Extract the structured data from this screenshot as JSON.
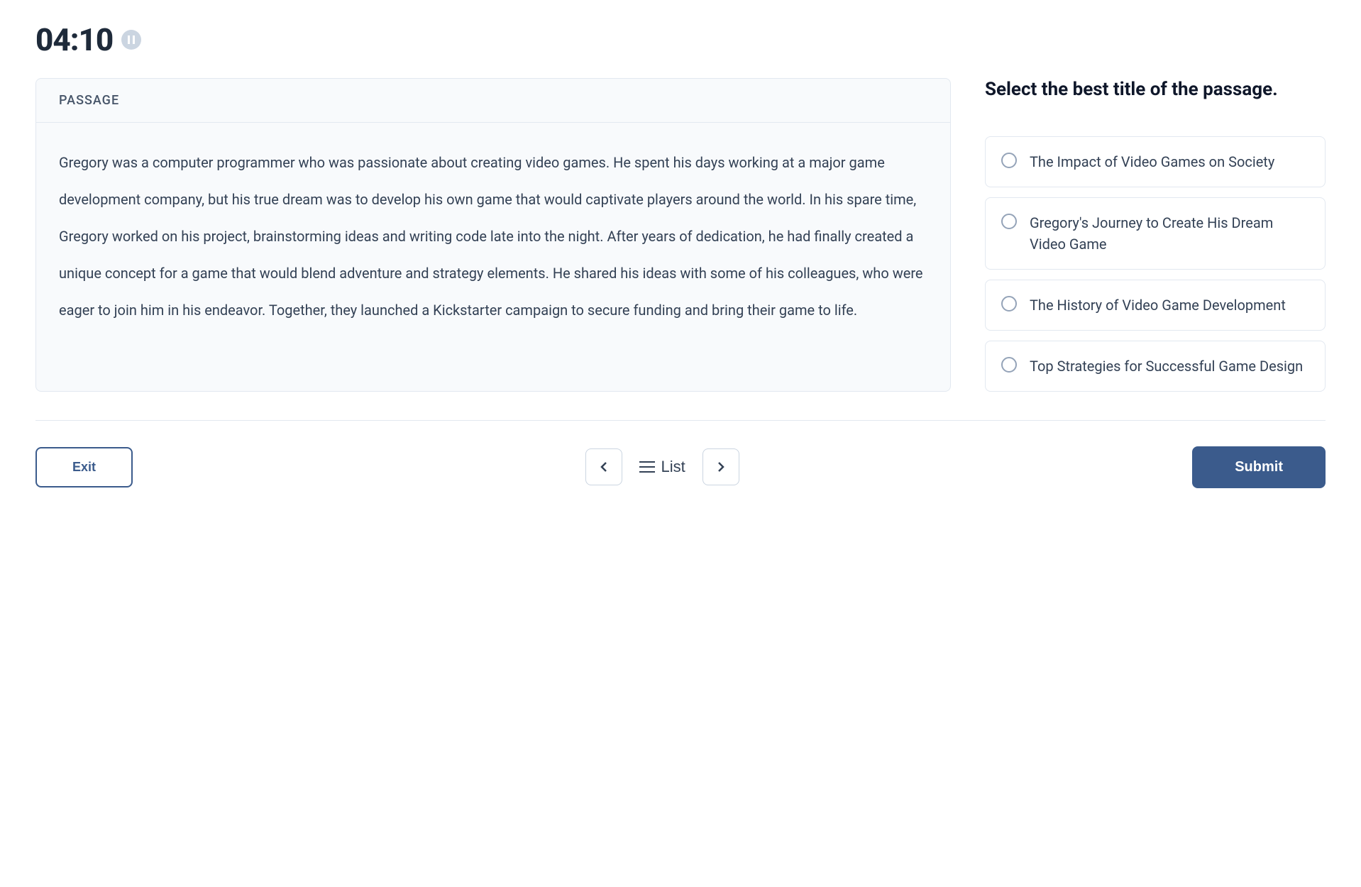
{
  "timer": {
    "value": "04:10"
  },
  "passage": {
    "header": "PASSAGE",
    "body": "Gregory was a computer programmer who was passionate about creating video games. He spent his days working at a major game development company, but his true dream was to develop his own game that would captivate players around the world. In his spare time, Gregory worked on his project, brainstorming ideas and writing code late into the night. After years of dedication, he had finally created a unique concept for a game that would blend adventure and strategy elements. He shared his ideas with some of his colleagues, who were eager to join him in his endeavor. Together, they launched a Kickstarter campaign to secure funding and bring their game to life."
  },
  "question": {
    "prompt": "Select the best title of the passage.",
    "options": [
      "The Impact of Video Games on Society",
      "Gregory's Journey to Create His Dream Video Game",
      "The History of Video Game Development",
      "Top Strategies for Successful Game Design"
    ]
  },
  "footer": {
    "exit": "Exit",
    "list": "List",
    "submit": "Submit"
  }
}
